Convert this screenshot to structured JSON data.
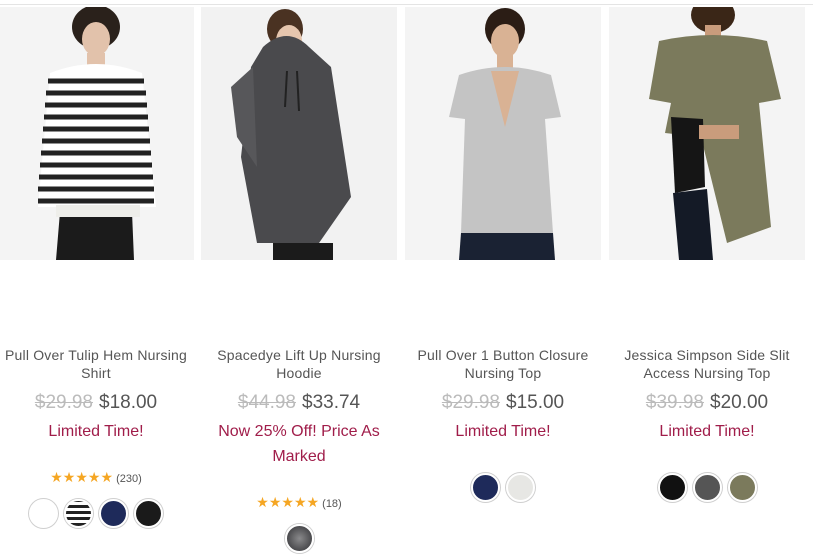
{
  "products": [
    {
      "name": "Pull Over Tulip Hem Nursing Shirt",
      "old_price": "$29.98",
      "price": "$18.00",
      "promo": "Limited Time!",
      "rating_count": "(230)",
      "stars": 5,
      "swatches": [
        "#ffffff",
        "stripe",
        "#1e2a5a",
        "#1a1a1a"
      ]
    },
    {
      "name": "Spacedye Lift Up Nursing Hoodie",
      "old_price": "$44.98",
      "price": "$33.74",
      "promo": "Now 25% Off! Price As Marked",
      "rating_count": "(18)",
      "stars": 5,
      "swatches": [
        "heather"
      ]
    },
    {
      "name": "Pull Over 1 Button Closure Nursing Top",
      "old_price": "$29.98",
      "price": "$15.00",
      "promo": "Limited Time!",
      "swatches": [
        "#1e2a5a",
        "#e7e7e4"
      ]
    },
    {
      "name": "Jessica Simpson Side Slit Access Nursing Top",
      "old_price": "$39.98",
      "price": "$20.00",
      "promo": "Limited Time!",
      "swatches": [
        "#111111",
        "#555555",
        "#7b7a5c"
      ]
    }
  ],
  "colors": {
    "promo": "#a01d4a",
    "star": "#f5a623",
    "old_price": "#bbbbbb"
  }
}
